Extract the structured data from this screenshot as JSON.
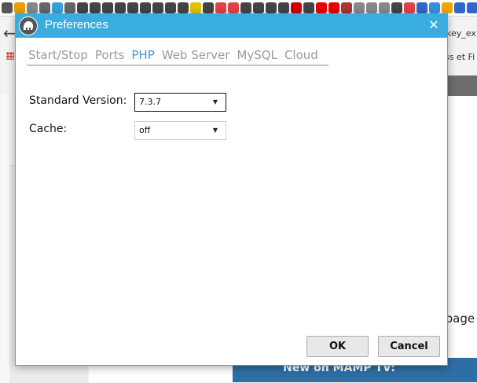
{
  "browser": {
    "tab_fragment": "key_ex",
    "bookmark_fragment": "ss et Fi",
    "page_fragment": "t page",
    "banner_text": "New on MAMP TV:"
  },
  "dialog": {
    "title": "Preferences",
    "close_glyph": "✕",
    "tabs": [
      "Start/Stop",
      "Ports",
      "PHP",
      "Web Server",
      "MySQL",
      "Cloud"
    ],
    "active_tab": "PHP",
    "standard_version_label": "Standard Version:",
    "standard_version_value": "7.3.7",
    "cache_label": "Cache:",
    "cache_value": "off",
    "ok_label": "OK",
    "cancel_label": "Cancel"
  },
  "colors": {
    "titlebar": "#3aade0",
    "active_tab": "#3a9ad6"
  },
  "icons": {
    "close": "close-icon",
    "dropdown": "chevron-down-icon",
    "back": "back-arrow-icon",
    "logo": "mamp-elephant-logo"
  }
}
